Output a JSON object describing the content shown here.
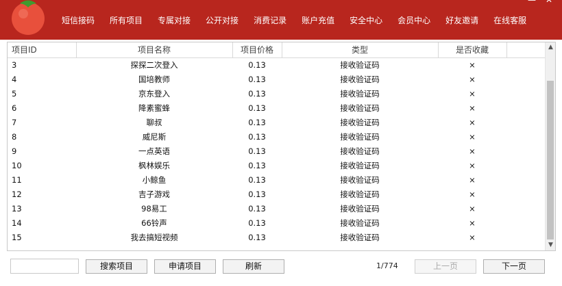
{
  "window": {
    "minimize_label": "—",
    "close_label": "✕"
  },
  "nav": {
    "items": [
      "短信接码",
      "所有项目",
      "专属对接",
      "公开对接",
      "消费记录",
      "账户充值",
      "安全中心",
      "会员中心",
      "好友邀请",
      "在线客服"
    ]
  },
  "colors": {
    "accent": "#b8261e",
    "logo_red": "#e8503c",
    "logo_green": "#3f9a2e"
  },
  "table": {
    "columns": [
      "项目ID",
      "项目名称",
      "项目价格",
      "类型",
      "是否收藏",
      ""
    ],
    "rows": [
      {
        "id": "3",
        "name": "探探二次登入",
        "price": "0.13",
        "type": "接收验证码",
        "fav": "×"
      },
      {
        "id": "4",
        "name": "国培教师",
        "price": "0.13",
        "type": "接收验证码",
        "fav": "×"
      },
      {
        "id": "5",
        "name": "京东登入",
        "price": "0.13",
        "type": "接收验证码",
        "fav": "×"
      },
      {
        "id": "6",
        "name": "降素蜜蜂",
        "price": "0.13",
        "type": "接收验证码",
        "fav": "×"
      },
      {
        "id": "7",
        "name": "聊叔",
        "price": "0.13",
        "type": "接收验证码",
        "fav": "×"
      },
      {
        "id": "8",
        "name": "威尼斯",
        "price": "0.13",
        "type": "接收验证码",
        "fav": "×"
      },
      {
        "id": "9",
        "name": "一点英语",
        "price": "0.13",
        "type": "接收验证码",
        "fav": "×"
      },
      {
        "id": "10",
        "name": "枫林娱乐",
        "price": "0.13",
        "type": "接收验证码",
        "fav": "×"
      },
      {
        "id": "11",
        "name": "小鲸鱼",
        "price": "0.13",
        "type": "接收验证码",
        "fav": "×"
      },
      {
        "id": "12",
        "name": "吉子游戏",
        "price": "0.13",
        "type": "接收验证码",
        "fav": "×"
      },
      {
        "id": "13",
        "name": "98易工",
        "price": "0.13",
        "type": "接收验证码",
        "fav": "×"
      },
      {
        "id": "14",
        "name": "66铃声",
        "price": "0.13",
        "type": "接收验证码",
        "fav": "×"
      },
      {
        "id": "15",
        "name": "我去搞短视频",
        "price": "0.13",
        "type": "接收验证码",
        "fav": "×"
      }
    ],
    "scroll_up_icon": "chevron-up-icon",
    "scroll_down_icon": "chevron-down-icon"
  },
  "footer": {
    "search_value": "",
    "search_button": "搜索项目",
    "apply_button": "申请项目",
    "refresh_button": "刷新",
    "page_info": "1/774",
    "prev_button": "上一页",
    "next_button": "下一页"
  }
}
